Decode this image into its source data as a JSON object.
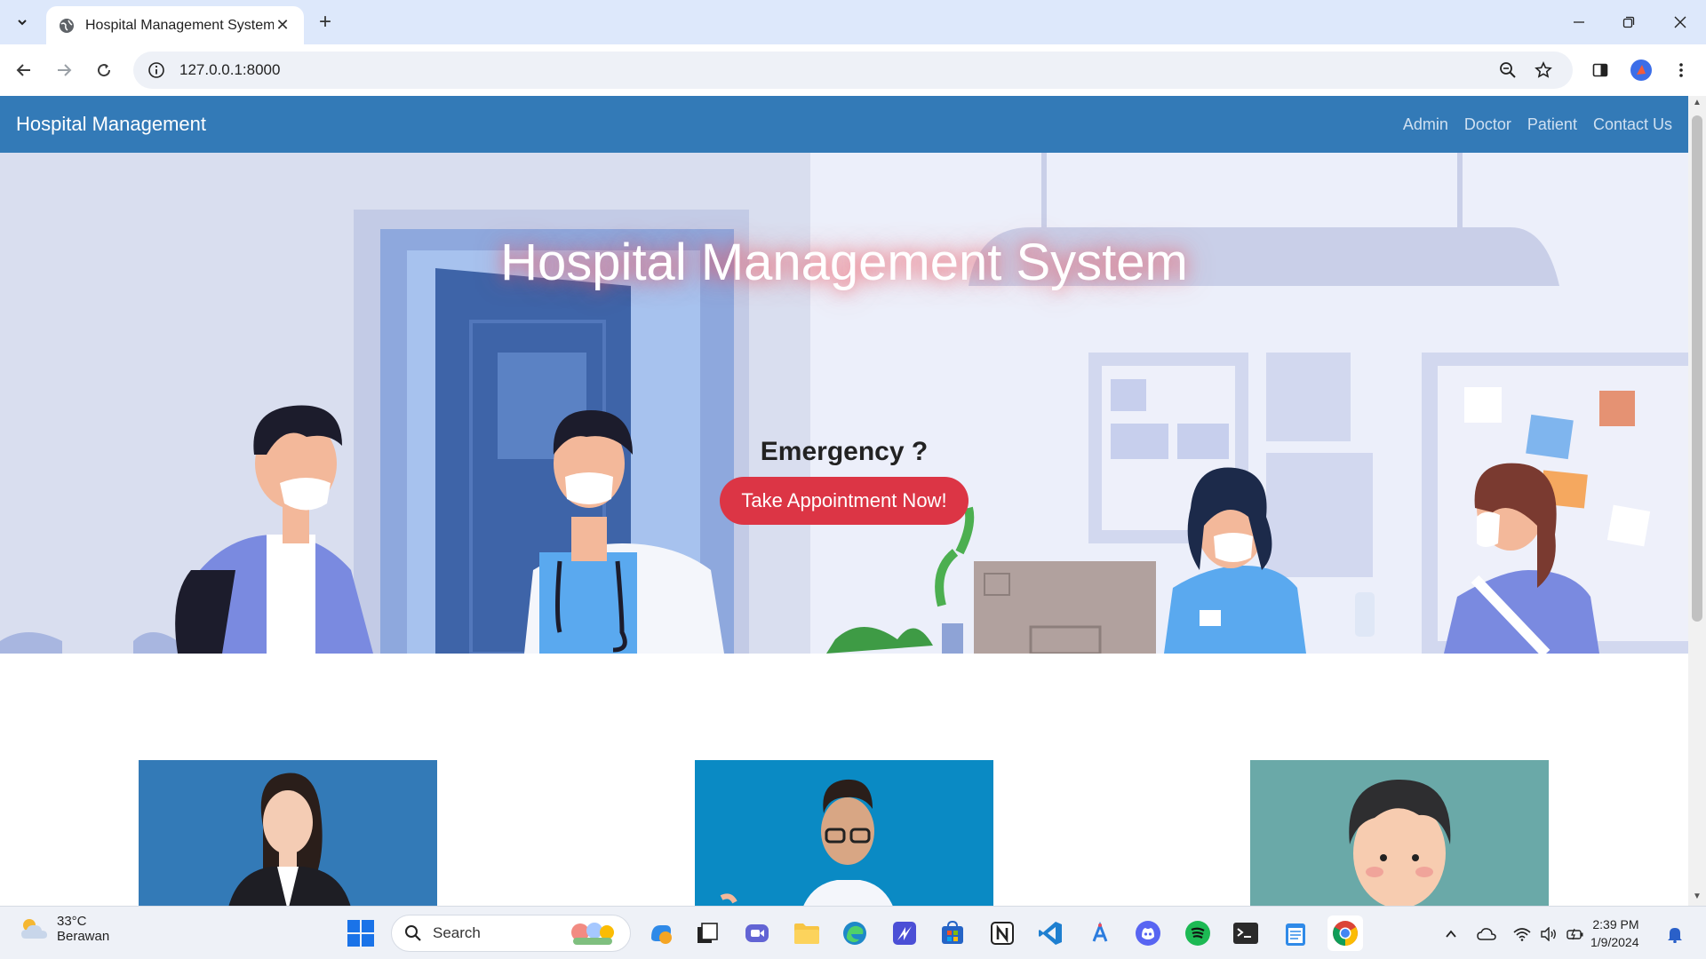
{
  "browser": {
    "tab_title": "Hospital Management System",
    "url": "127.0.0.1:8000"
  },
  "site": {
    "brand": "Hospital Management",
    "nav": [
      "Admin",
      "Doctor",
      "Patient",
      "Contact Us"
    ],
    "hero": {
      "title": "Hospital Management System",
      "emergency": "Emergency ?",
      "cta": "Take Appointment Now!"
    }
  },
  "taskbar": {
    "weather_temp": "33°C",
    "weather_cond": "Berawan",
    "search_label": "Search",
    "time": "2:39 PM",
    "date": "1/9/2024"
  },
  "colors": {
    "navbar": "#337ab7",
    "cta": "#dc3545"
  }
}
